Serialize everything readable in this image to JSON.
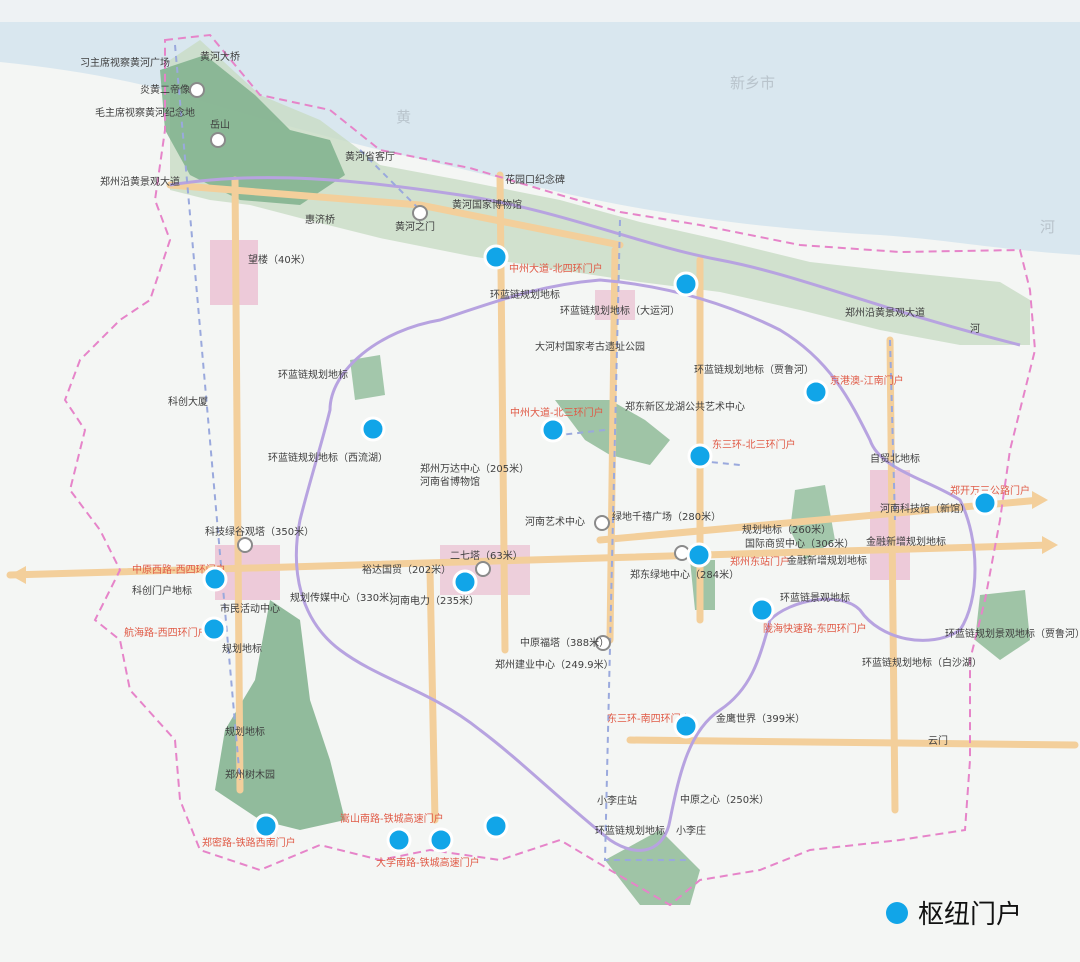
{
  "legend": {
    "hub_label": "枢纽门户",
    "hub_color": "#11a5e8"
  },
  "colors": {
    "river": "#d9e7ef",
    "forest": "#7fb08c",
    "ring_road": "#b7a3e0",
    "arterial": "#f3cf9b",
    "boundary": "#e684c9",
    "cbd": "#e8aec6"
  },
  "places": [
    "习主席视察黄河广场",
    "黄河大桥",
    "炎黄二帝像",
    "毛主席视察黄河纪念地",
    "岳山",
    "黄河省客厅",
    "郑州沿黄景观大道",
    "花园口纪念碑",
    "黄河国家博物馆",
    "惠济桥",
    "黄河之门",
    "望楼（40米）",
    "中州大道-北四环门户",
    "环蓝链规划地标",
    "环蓝链规划地标（大运河）",
    "大河村国家考古遗址公园",
    "新乡市",
    "郑州沿黄景观大道",
    "环蓝链规划地标",
    "环蓝链规划地标（贾鲁河）",
    "科创大厦",
    "中州大道-北三环门户",
    "郑东新区龙湖公共艺术中心",
    "京港澳-江南门户",
    "环蓝链规划地标（西流湖）",
    "郑州万达中心（205米）",
    "河南省博物馆",
    "自贸北地标",
    "东三环-北三环门户",
    "郑开万三公路门户",
    "河南科技馆（新馆）",
    "科技绿谷观塔（350米）",
    "河南艺术中心",
    "绿地千禧广场（280米）",
    "规划地标（260米）",
    "国际商贸中心（306米）",
    "金融新增规划地标",
    "中原西路-西四环门户",
    "二七塔（63米）",
    "裕达国贸（202米）",
    "郑东绿地中心（284米）",
    "郑州东站门户",
    "金融新增规划地标",
    "科创门户地标",
    "市民活动中心",
    "规划传媒中心（330米）",
    "河南电力（235米）",
    "航海路-西四环门户",
    "规划地标",
    "环蓝链景观地标",
    "陇海快速路-东四环门户",
    "环蓝链规划景观地标（贾鲁河）",
    "中原福塔（388米）",
    "郑州建业中心（249.9米）",
    "环蓝链规划地标（白沙湖）",
    "东三环-南四环门户",
    "金鹰世界（399米）",
    "规划地标",
    "云门",
    "郑州树木园",
    "小李庄站",
    "中原之心（250米）",
    "郑密路-铁路西南门户",
    "嵩山南路-铁城高速门户",
    "大学南路-铁城高速门户",
    "环蓝链规划地标",
    "小李庄",
    "黄",
    "河",
    "河"
  ]
}
